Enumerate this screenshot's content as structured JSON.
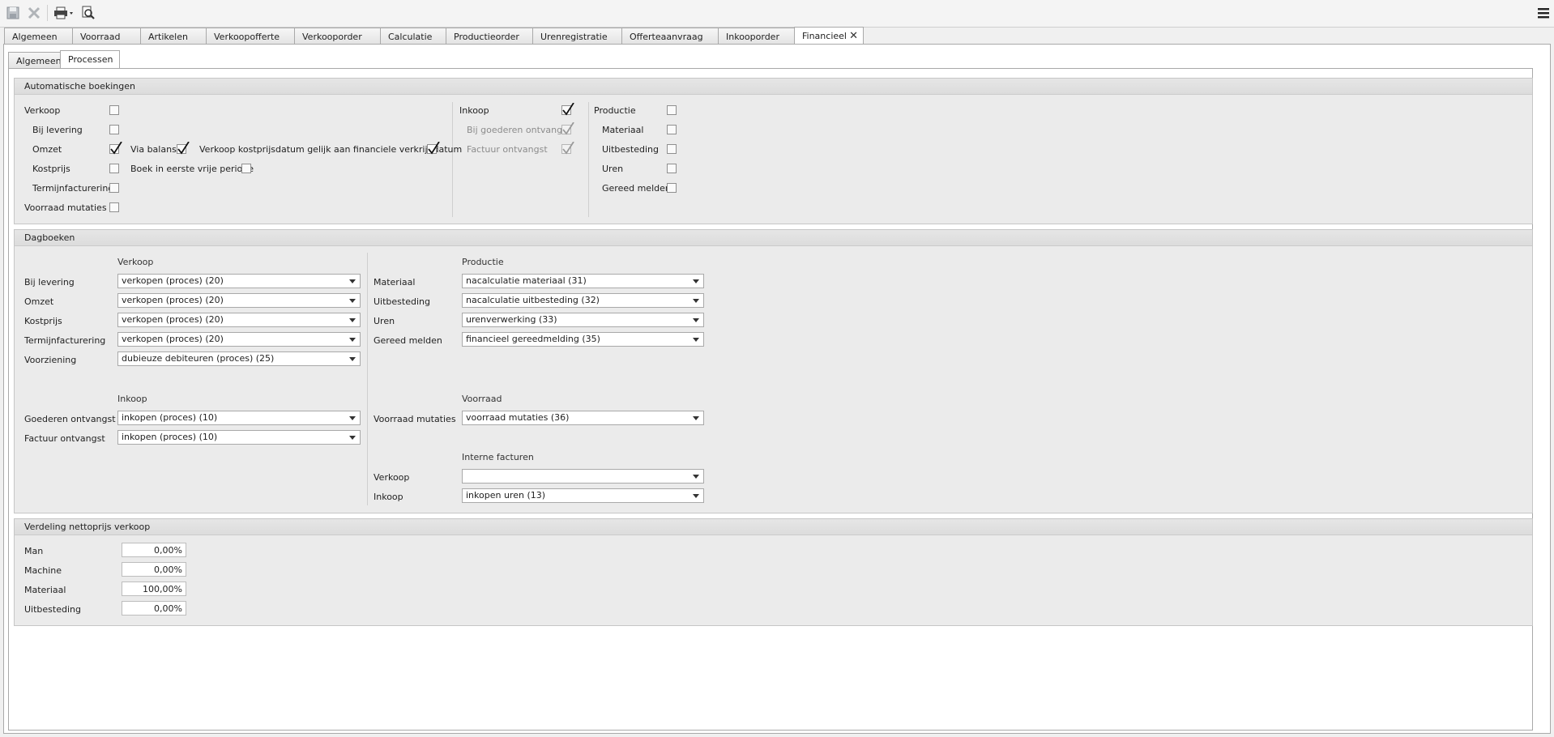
{
  "tabs_main": [
    "Algemeen",
    "Voorraad",
    "Artikelen",
    "Verkoopofferte",
    "Verkooporder",
    "Calculatie",
    "Productieorder",
    "Urenregistratie",
    "Offerteaanvraag",
    "Inkooporder",
    "Financieel"
  ],
  "tabs_sub": [
    "Algemeen",
    "Processen"
  ],
  "auto": {
    "title": "Automatische boekingen",
    "verkoop": "Verkoop",
    "bij_levering": "Bij levering",
    "omzet": "Omzet",
    "kostprijs": "Kostprijs",
    "termijn": "Termijnfacturering",
    "voorraad_mutaties": "Voorraad mutaties",
    "via_balans": "Via balans",
    "kostprijsdatum": "Verkoop kostprijsdatum gelijk aan financiele verkrijgdatum",
    "eerste_vrije": "Boek in eerste vrije periode",
    "inkoop": "Inkoop",
    "bij_goederen": "Bij goederen ontvangst",
    "factuur": "Factuur ontvangst",
    "productie": "Productie",
    "materiaal": "Materiaal",
    "uitbesteding": "Uitbesteding",
    "uren": "Uren",
    "gereed": "Gereed melden"
  },
  "dag": {
    "title": "Dagboeken",
    "verkoop_header": "Verkoop",
    "productie_header": "Productie",
    "inkoop_header": "Inkoop",
    "voorraad_header": "Voorraad",
    "interne_header": "Interne facturen",
    "labels": {
      "bij_levering": "Bij levering",
      "omzet": "Omzet",
      "kostprijs": "Kostprijs",
      "termijn": "Termijnfacturering",
      "voorziening": "Voorziening",
      "goederen": "Goederen ontvangst",
      "factuur": "Factuur ontvangst",
      "materiaal": "Materiaal",
      "uitbesteding": "Uitbesteding",
      "uren": "Uren",
      "gereed": "Gereed melden",
      "voorraad_mutaties": "Voorraad mutaties",
      "int_verkoop": "Verkoop",
      "int_inkoop": "Inkoop"
    },
    "values": {
      "bij_levering": "verkopen (proces) (20)",
      "omzet": "verkopen (proces) (20)",
      "kostprijs": "verkopen (proces) (20)",
      "termijn": "verkopen (proces) (20)",
      "voorziening": "dubieuze debiteuren (proces) (25)",
      "goederen": "inkopen (proces) (10)",
      "factuur": "inkopen (proces) (10)",
      "materiaal": "nacalculatie materiaal (31)",
      "uitbesteding": "nacalculatie uitbesteding (32)",
      "uren": "urenverwerking (33)",
      "gereed": "financieel gereedmelding (35)",
      "voorraad_mutaties": "voorraad mutaties (36)",
      "int_verkoop": "",
      "int_inkoop": "inkopen uren (13)"
    }
  },
  "verdeling": {
    "title": "Verdeling nettoprijs verkoop",
    "man": "Man",
    "machine": "Machine",
    "materiaal": "Materiaal",
    "uitbesteding": "Uitbesteding",
    "values": {
      "man": "0,00%",
      "machine": "0,00%",
      "materiaal": "100,00%",
      "uitbesteding": "0,00%"
    }
  }
}
